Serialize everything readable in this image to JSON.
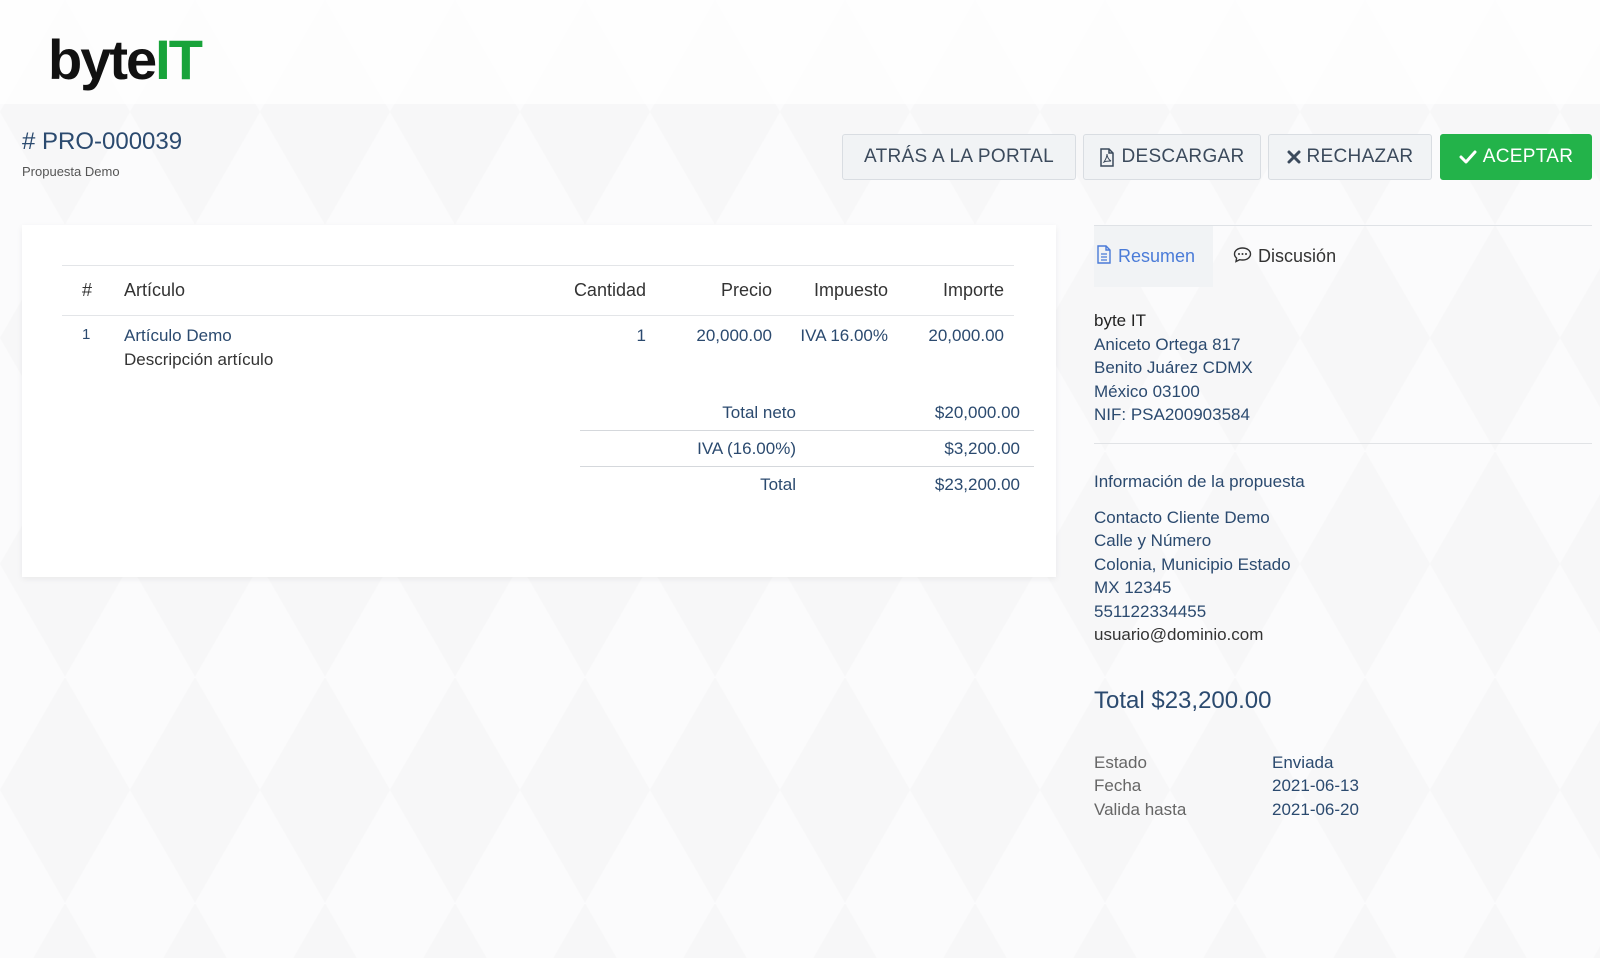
{
  "logo": {
    "part1": "byte",
    "part2": "IT"
  },
  "document": {
    "number": "# PRO-000039",
    "subtitle": "Propuesta Demo"
  },
  "actions": {
    "back_label": "ATRÁS A LA PORTAL",
    "download_label": "DESCARGAR",
    "reject_label": "RECHAZAR",
    "accept_label": "ACEPTAR"
  },
  "table": {
    "headers": {
      "num": "#",
      "item": "Artículo",
      "qty": "Cantidad",
      "price": "Precio",
      "tax": "Impuesto",
      "amount": "Importe"
    },
    "rows": [
      {
        "num": "1",
        "name": "Artículo Demo",
        "description": "Descripción artículo",
        "qty": "1",
        "price": "20,000.00",
        "tax": "IVA 16.00%",
        "amount": "20,000.00"
      }
    ]
  },
  "totals": {
    "net_label": "Total neto",
    "net_value": "$20,000.00",
    "tax_label": "IVA (16.00%)",
    "tax_value": "$3,200.00",
    "total_label": "Total",
    "total_value": "$23,200.00"
  },
  "tabs": {
    "summary": "Resumen",
    "discussion": "Discusión"
  },
  "company": {
    "name": "byte IT",
    "line1": "Aniceto Ortega 817",
    "line2": "Benito Juárez CDMX",
    "line3": "México 03100",
    "line4": "NIF: PSA200903584"
  },
  "proposal_info": {
    "heading": "Información de la propuesta",
    "contact": "Contacto Cliente Demo",
    "street": "Calle y Número",
    "area": "Colonia, Municipio Estado",
    "postal": "MX 12345",
    "phone": "551122334455",
    "email": "usuario@dominio.com"
  },
  "grand_total": "Total $23,200.00",
  "meta": {
    "status_label": "Estado",
    "status_value": "Enviada",
    "date_label": "Fecha",
    "date_value": "2021-06-13",
    "valid_label": "Valida hasta",
    "valid_value": "2021-06-20"
  },
  "colors": {
    "accent_green": "#23b34a",
    "link_blue": "#4a7bd8",
    "text_navy": "#2b4a6f"
  }
}
